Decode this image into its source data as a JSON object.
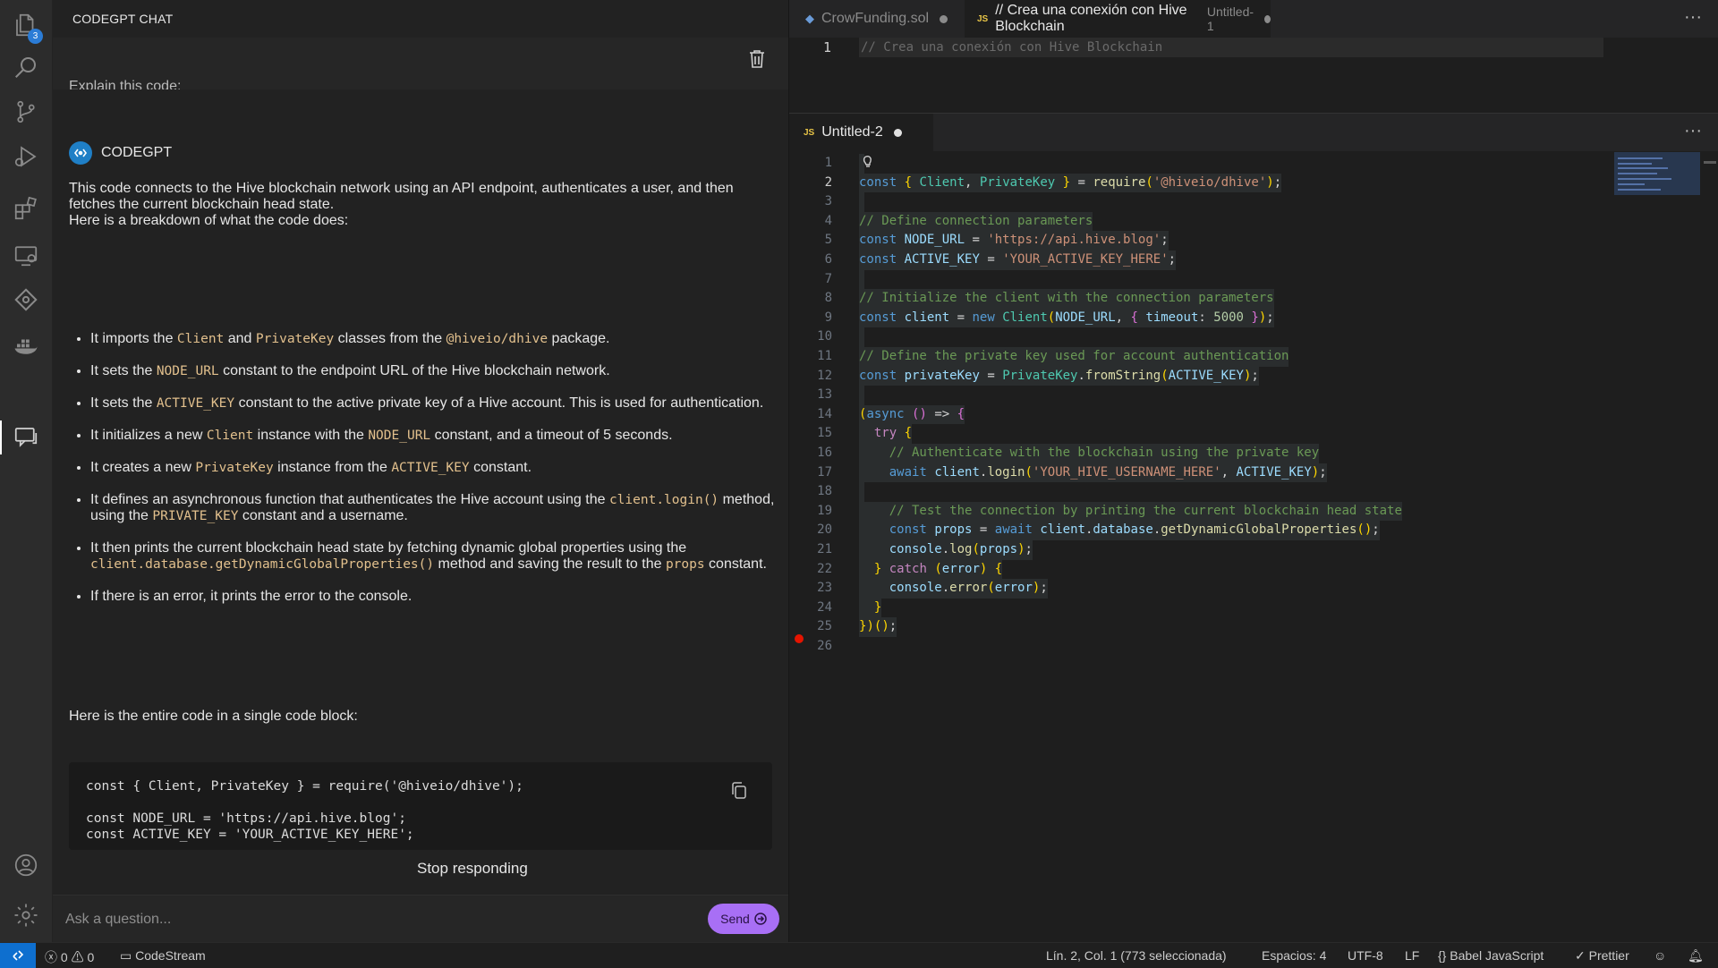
{
  "activity_bar": {
    "explorer_badge": "3"
  },
  "chat_panel": {
    "title": "CODEGPT CHAT",
    "prev_user_message": "Explain this code:",
    "bot_name": "CODEGPT",
    "intro": "This code connects to the Hive blockchain network using an API endpoint, authenticates a user, and then fetches the current blockchain head state.",
    "breakdown_heading": "Here is a breakdown of what the code does:",
    "bullets": [
      {
        "parts": [
          [
            "t",
            "It imports the "
          ],
          [
            "c",
            "Client"
          ],
          [
            "t",
            " and "
          ],
          [
            "c",
            "PrivateKey"
          ],
          [
            "t",
            " classes from the "
          ],
          [
            "c",
            "@hiveio/dhive"
          ],
          [
            "t",
            " package."
          ]
        ]
      },
      {
        "parts": [
          [
            "t",
            "It sets the "
          ],
          [
            "c",
            "NODE_URL"
          ],
          [
            "t",
            " constant to the endpoint URL of the Hive blockchain network."
          ]
        ]
      },
      {
        "parts": [
          [
            "t",
            "It sets the "
          ],
          [
            "c",
            "ACTIVE_KEY"
          ],
          [
            "t",
            " constant to the active private key of a Hive account. This is used for authentication."
          ]
        ]
      },
      {
        "parts": [
          [
            "t",
            "It initializes a new "
          ],
          [
            "c",
            "Client"
          ],
          [
            "t",
            " instance with the "
          ],
          [
            "c",
            "NODE_URL"
          ],
          [
            "t",
            " constant, and a timeout of 5 seconds."
          ]
        ]
      },
      {
        "parts": [
          [
            "t",
            "It creates a new "
          ],
          [
            "c",
            "PrivateKey"
          ],
          [
            "t",
            " instance from the "
          ],
          [
            "c",
            "ACTIVE_KEY"
          ],
          [
            "t",
            " constant."
          ]
        ]
      },
      {
        "parts": [
          [
            "t",
            "It defines an asynchronous function that authenticates the Hive account using the "
          ],
          [
            "c",
            "client.login()"
          ],
          [
            "t",
            " method, using the "
          ],
          [
            "c",
            "PRIVATE_KEY"
          ],
          [
            "t",
            " constant and a username."
          ]
        ]
      },
      {
        "parts": [
          [
            "t",
            "It then prints the current blockchain head state by fetching dynamic global properties using the "
          ],
          [
            "c",
            "client.database.getDynamicGlobalProperties()"
          ],
          [
            "t",
            " method and saving the result to the "
          ],
          [
            "c",
            "props"
          ],
          [
            "t",
            " constant."
          ]
        ]
      },
      {
        "parts": [
          [
            "t",
            "If there is an error, it prints the error to the console."
          ]
        ]
      }
    ],
    "entire_code_heading": "Here is the entire code in a single code block:",
    "code_block_lines": [
      "const { Client, PrivateKey } = require('@hiveio/dhive');",
      "",
      "const NODE_URL = 'https://api.hive.blog';",
      "const ACTIVE_KEY = 'YOUR_ACTIVE_KEY_HERE';"
    ],
    "stop_label": "Stop responding",
    "input_placeholder": "Ask a question...",
    "send_label": "Send"
  },
  "editor_top": {
    "tabs": [
      {
        "lang": "",
        "label": "CrowFunding.sol",
        "desc": "",
        "active": false
      },
      {
        "lang": "JS",
        "label": "// Crea una conexión con Hive Blockchain",
        "desc": "Untitled-1",
        "active": true
      }
    ],
    "line_number": "1",
    "line_text": "// Crea una conexión con Hive Blockchain"
  },
  "editor_bottom": {
    "tab": {
      "lang": "JS",
      "label": "Untitled-2"
    },
    "line_numbers": [
      "1",
      "2",
      "3",
      "4",
      "5",
      "6",
      "7",
      "8",
      "9",
      "10",
      "11",
      "12",
      "13",
      "14",
      "15",
      "16",
      "17",
      "18",
      "19",
      "20",
      "21",
      "22",
      "23",
      "24",
      "25",
      "26"
    ],
    "lines": [
      "",
      "const { Client, PrivateKey } = require('@hiveio/dhive');",
      "",
      "// Define connection parameters",
      "const NODE_URL = 'https://api.hive.blog';",
      "const ACTIVE_KEY = 'YOUR_ACTIVE_KEY_HERE';",
      "",
      "// Initialize the client with the connection parameters",
      "const client = new Client(NODE_URL, { timeout: 5000 });",
      "",
      "// Define the private key used for account authentication",
      "const privateKey = PrivateKey.fromString(ACTIVE_KEY);",
      "",
      "(async () => {",
      "  try {",
      "    // Authenticate with the blockchain using the private key",
      "    await client.login('YOUR_HIVE_USERNAME_HERE', ACTIVE_KEY);",
      "",
      "    // Test the connection by printing the current blockchain head state",
      "    const props = await client.database.getDynamicGlobalProperties();",
      "    console.log(props);",
      "  } catch (error) {",
      "    console.error(error);",
      "  }",
      "})();",
      ""
    ]
  },
  "status_bar": {
    "errors": "0",
    "warnings": "0",
    "codestream": "CodeStream",
    "position": "Lín. 2, Col. 1 (773 seleccionada)",
    "spaces": "Espacios: 4",
    "encoding": "UTF-8",
    "eol": "LF",
    "language": "Babel JavaScript",
    "formatter": "Prettier"
  },
  "colors": {
    "accent_send": "#a86ff5",
    "remote_blue": "#0e6fcf",
    "inline_code": "#e2c08d",
    "badge_blue": "#2b7cd6"
  }
}
